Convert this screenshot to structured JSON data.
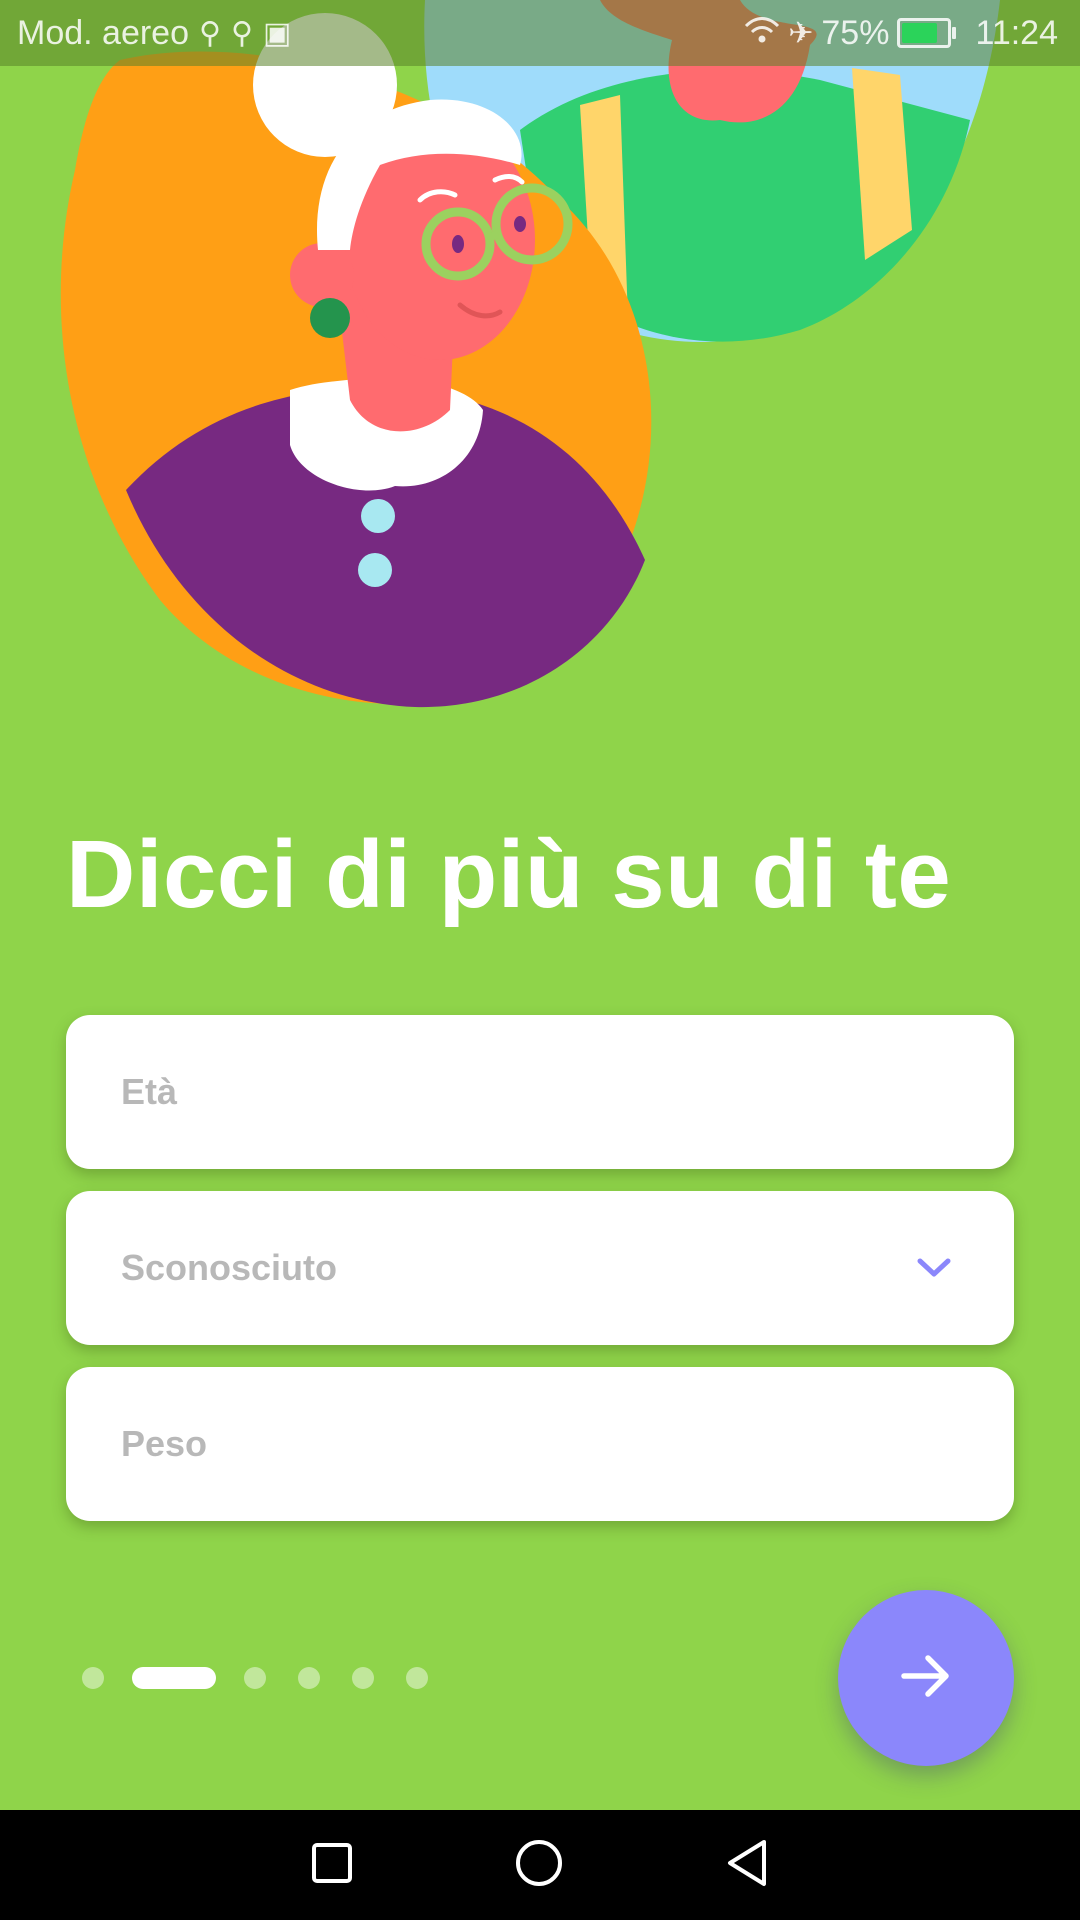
{
  "status_bar": {
    "carrier": "Mod. aereo",
    "battery_percent": "75%",
    "time": "11:24",
    "left_icons": [
      "usb-icon",
      "usb-icon",
      "notification-icon"
    ],
    "right_icons": [
      "wifi-icon",
      "airplane-mode-icon",
      "battery-charging-icon"
    ]
  },
  "onboarding": {
    "title": "Dicci di più su di te",
    "fields": {
      "age_placeholder": "Età",
      "sex_value": "Sconosciuto",
      "weight_placeholder": "Peso"
    },
    "pager": {
      "total_pages": 6,
      "current_page": 2
    },
    "next_button_icon": "arrow-right-icon"
  },
  "colors": {
    "background": "#8fd44a",
    "accent": "#8b87fb",
    "field_background": "#ffffff",
    "placeholder": "#b8b8b8"
  },
  "navigation_bar": {
    "buttons": [
      "recent-apps-icon",
      "home-icon",
      "back-icon"
    ]
  }
}
